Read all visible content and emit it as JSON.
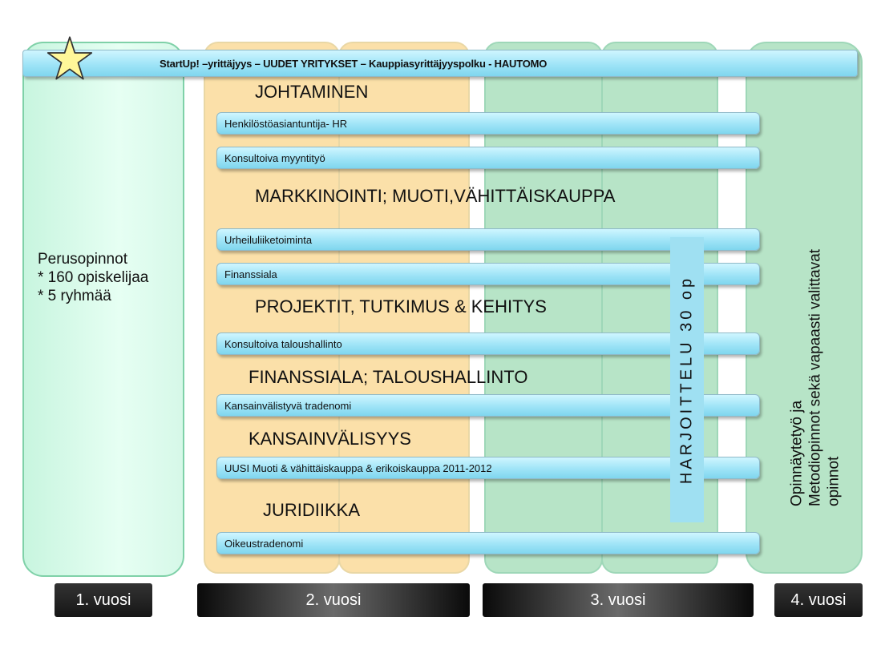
{
  "top_band": {
    "label": "StartUp! –yrittäjyys – UUDET YRITYKSET – Kauppiasyrittäjyyspolku - HAUTOMO"
  },
  "year1": {
    "lines": [
      "Perusopinnot",
      "* 160 opiskelijaa",
      "* 5 ryhmää"
    ]
  },
  "headings": {
    "johtaminen": "JOHTAMINEN",
    "markkinointi": "MARKKINOINTI; MUOTI,VÄHITTÄISKAUPPA",
    "projektit": "PROJEKTIT, TUTKIMUS & KEHITYS",
    "finanssiala": "FINANSSIALA; TALOUSHALLINTO",
    "kansainvalisyys": "KANSAINVÄLISYYS",
    "juridiikka": "JURIDIIKKA"
  },
  "tracks": {
    "hr": "Henkilöstöasiantuntija- HR",
    "myyntityo": "Konsultoiva myyntityö",
    "urheilu": "Urheiluliiketoiminta",
    "finanssi": "Finanssiala",
    "talous": "Konsultoiva taloushallinto",
    "kansainvalinen": "Kansainvälistyvä tradenomi",
    "muoti": "UUSI Muoti & vähittäiskauppa & erikoiskauppa 2011-2012",
    "oikeus": "Oikeustradenomi"
  },
  "harjoittelu": "HARJOITTELU 30 op",
  "year4_text": {
    "line1": "Opinnäytetyö ja",
    "line2": "Metodiopinnot sekä vapaasti valittavat",
    "line3": "opinnot"
  },
  "year_labels": {
    "y1": "1. vuosi",
    "y2": "2. vuosi",
    "y3": "3. vuosi",
    "y4": "4. vuosi"
  },
  "colors": {
    "year1": "#d6f8e8",
    "year2": "#fbe0a9",
    "year3": "#b7e4c7",
    "band": "#9fe4f7",
    "star": "#fff799"
  }
}
